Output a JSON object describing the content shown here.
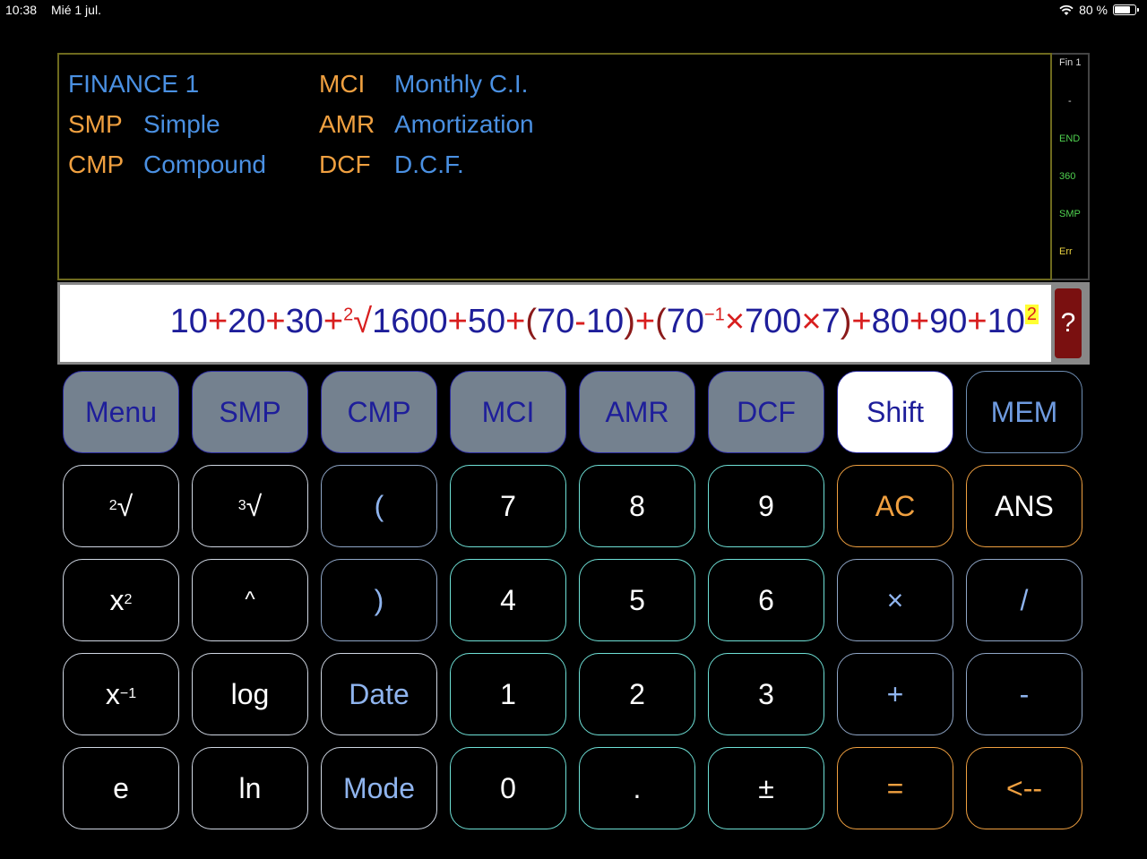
{
  "status_bar": {
    "time": "10:38",
    "date": "Mié 1 jul.",
    "battery": "80 %",
    "battery_level": 0.8
  },
  "display": {
    "title": "FINANCE 1",
    "menu": [
      {
        "key": "SMP",
        "desc": "Simple"
      },
      {
        "key": "CMP",
        "desc": "Compound"
      },
      {
        "key": "MCI",
        "desc": "Monthly C.I."
      },
      {
        "key": "AMR",
        "desc": "Amortization"
      },
      {
        "key": "DCF",
        "desc": "D.C.F."
      }
    ]
  },
  "indicators": {
    "mode": "Fin 1",
    "dash": "-",
    "end": "END",
    "days": "360",
    "type": "SMP",
    "err": "Err"
  },
  "expression": {
    "parts": [
      "10",
      "+",
      "20",
      "+",
      "30",
      "+",
      "2",
      "√",
      "1600",
      "+",
      "50",
      "+",
      "(",
      "70",
      "-",
      "10",
      ")",
      "+",
      "(",
      "70",
      "−1",
      "×",
      "700",
      "×",
      "7",
      ")",
      "+",
      "80",
      "+",
      "90",
      "+",
      "10",
      "2"
    ],
    "help_label": "?"
  },
  "keys": {
    "top": [
      "Menu",
      "SMP",
      "CMP",
      "MCI",
      "AMR",
      "DCF",
      "Shift",
      "MEM"
    ],
    "row1": [
      "√",
      "√",
      "(",
      "7",
      "8",
      "9",
      "AC",
      "ANS"
    ],
    "row1_sup": [
      "2",
      "3"
    ],
    "row2": [
      "x",
      "^",
      ")",
      "4",
      "5",
      "6",
      "×",
      "/"
    ],
    "row2_sup": "2",
    "row3": [
      "x",
      "log",
      "Date",
      "1",
      "2",
      "3",
      "+",
      "-"
    ],
    "row3_sup": "−1",
    "row4": [
      "e",
      "ln",
      "Mode",
      "0",
      ".",
      "±",
      "=",
      "<--"
    ]
  },
  "colors": {
    "background": "#000000",
    "menu_blue": "#4a90e2",
    "menu_orange": "#f0a040",
    "indicator_green": "#4fd14f",
    "err_yellow": "#e8d040",
    "expr_digit": "#1e1e9a",
    "expr_op": "#d81e1e",
    "top_key_gray": "#74818f",
    "num_key_border": "#6ee0d6",
    "help_red": "#7a1010"
  }
}
